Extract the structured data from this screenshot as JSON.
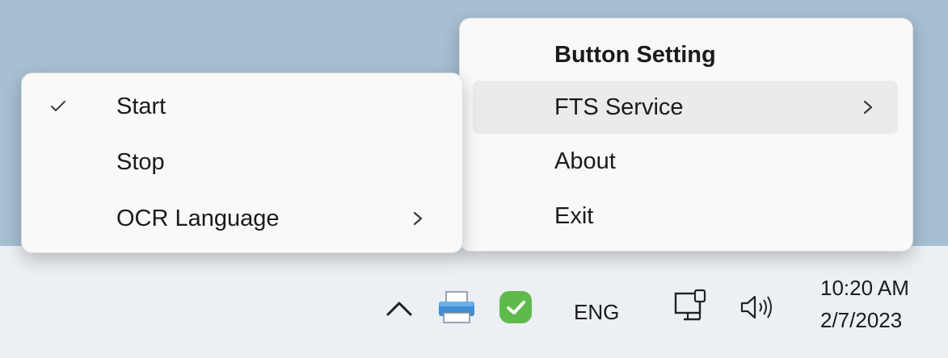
{
  "main_menu": {
    "title": "Button Setting",
    "items": [
      {
        "label": "FTS Service",
        "has_submenu": true
      },
      {
        "label": "About"
      },
      {
        "label": "Exit"
      }
    ]
  },
  "submenu": {
    "items": [
      {
        "label": "Start",
        "checked": true
      },
      {
        "label": "Stop"
      },
      {
        "label": "OCR Language",
        "has_submenu": true
      }
    ]
  },
  "taskbar": {
    "language": "ENG",
    "time": "10:20 AM",
    "date": "2/7/2023",
    "icons": [
      "chevron-up-icon",
      "printer-icon",
      "checkmark-shield-icon",
      "network-monitor-icon",
      "speaker-icon"
    ]
  },
  "colors": {
    "desktop": "#a7bfd2",
    "taskbar": "#eceff3",
    "menu_bg": "#f9f9f9",
    "hover_bg": "#ebebeb",
    "app_icon_green": "#5fba4c"
  }
}
